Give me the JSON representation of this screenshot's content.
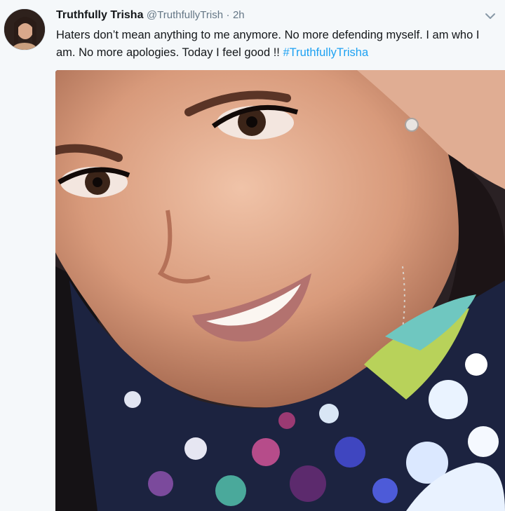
{
  "tweet": {
    "display_name": "Truthfully Trisha",
    "handle": "@TruthfullyTrish",
    "separator": "·",
    "time": "2h",
    "text_main": "Haters don’t mean anything to me anymore. No more defending myself. I am who I am. No more apologies. Today I feel good !! ",
    "hashtag": "#TruthfullyTrisha",
    "colors": {
      "link": "#1da1f2",
      "secondary_text": "#657786",
      "background": "#f5f8fa"
    }
  },
  "icons": {
    "menu": "chevron-down-icon",
    "avatar": "avatar"
  }
}
